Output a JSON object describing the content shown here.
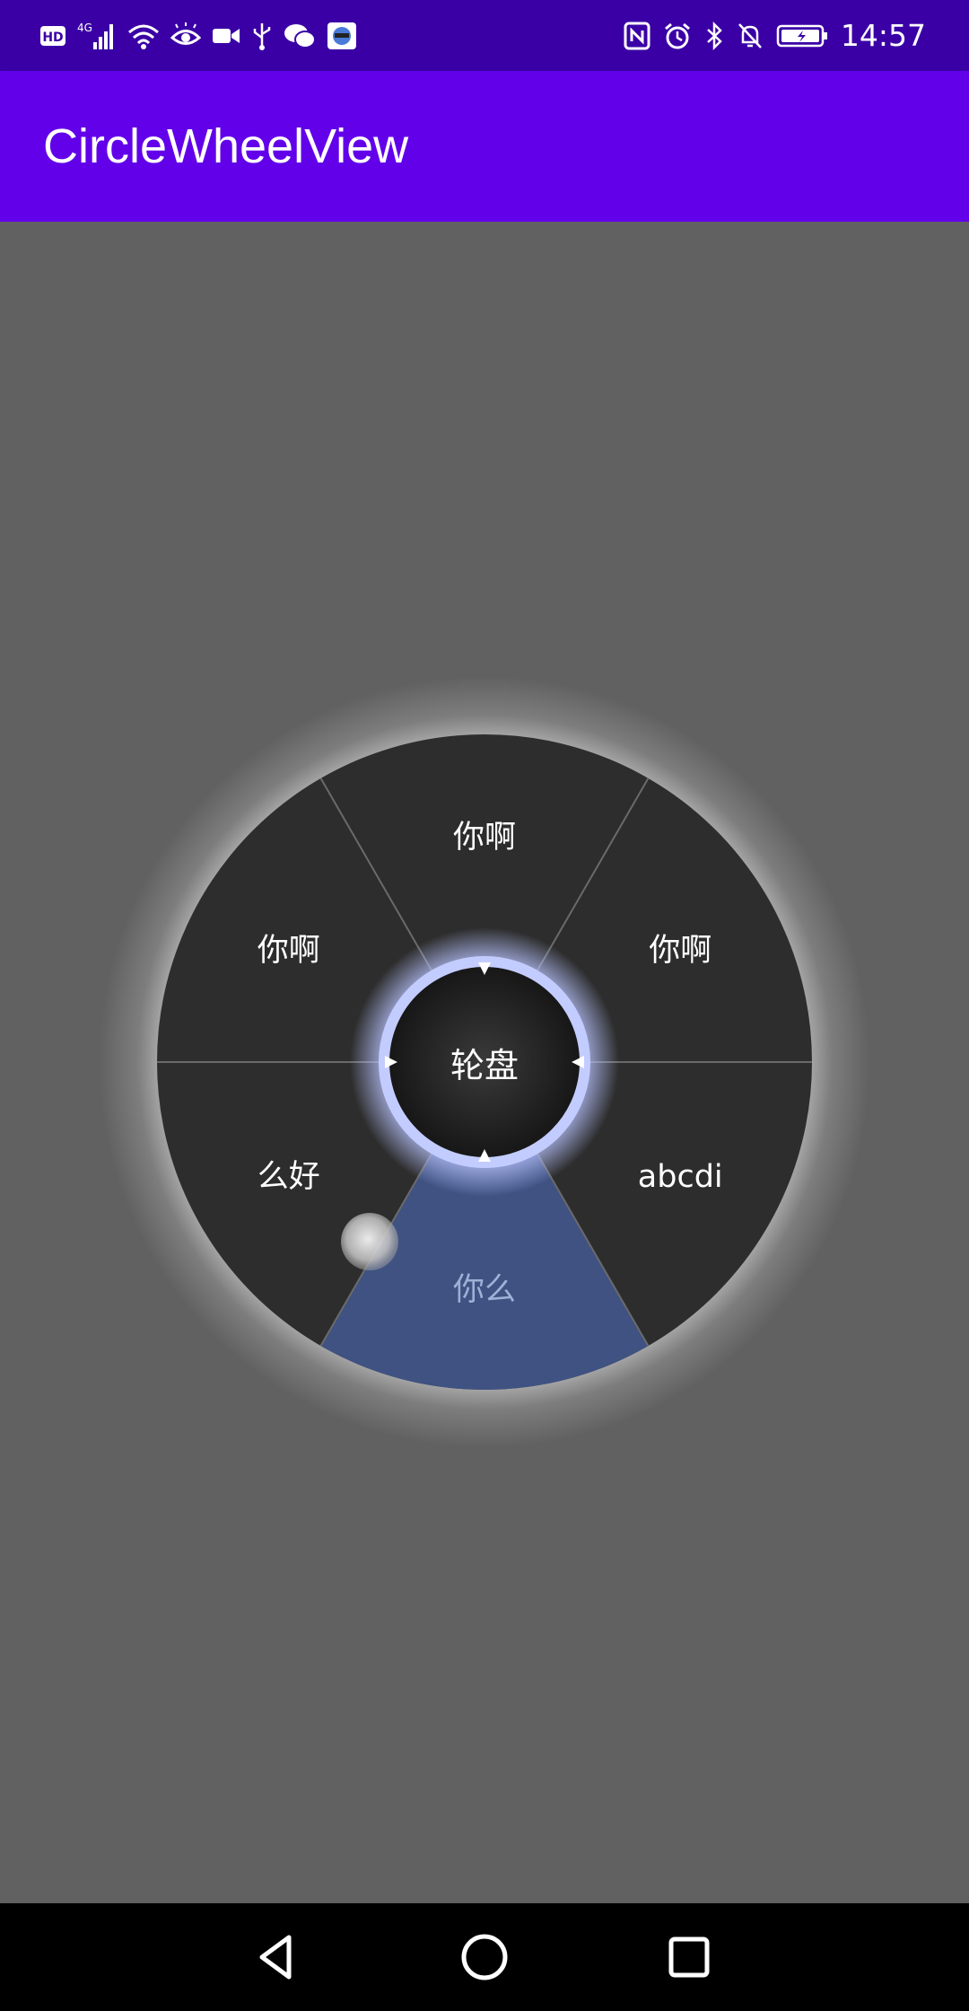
{
  "status_bar": {
    "left_icons": [
      "hd-icon",
      "signal-4g-icon",
      "wifi-icon",
      "eye-icon",
      "video-icon",
      "usb-icon",
      "wechat-icon",
      "avatar-app-icon"
    ],
    "right_icons": [
      "nfc-icon",
      "alarm-icon",
      "bluetooth-icon",
      "mute-bell-icon",
      "battery-icon"
    ],
    "time": "14:57"
  },
  "app_bar": {
    "title": "CircleWheelView",
    "color": "#6200ea",
    "status_color": "#3a00a6"
  },
  "wheel": {
    "center_label": "轮盘",
    "segments": [
      {
        "label": "你啊",
        "selected": false
      },
      {
        "label": "你啊",
        "selected": false
      },
      {
        "label": "abcdi",
        "selected": false
      },
      {
        "label": "你么",
        "selected": true
      },
      {
        "label": "么好",
        "selected": false
      },
      {
        "label": "你啊",
        "selected": false
      }
    ],
    "segment_color": "#2d2d2d",
    "selected_color": "#3f5282",
    "ring_color": "#aab8ff"
  },
  "nav_bar": {
    "buttons": [
      "back-icon",
      "home-icon",
      "recents-icon"
    ]
  }
}
